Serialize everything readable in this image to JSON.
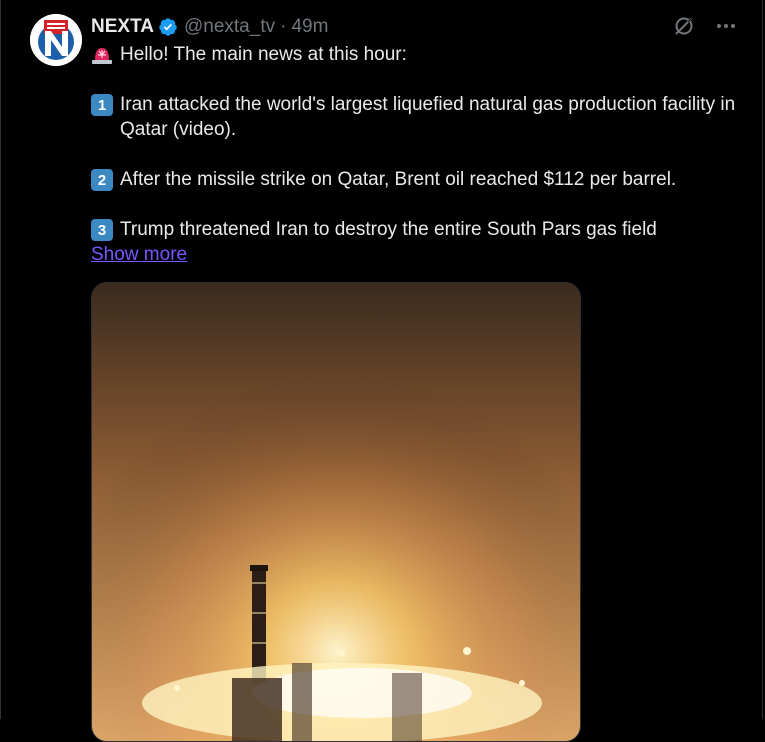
{
  "author": {
    "name": "NEXTA",
    "handle": "@nexta_tv",
    "separator": "·",
    "time": "49m",
    "verified": true,
    "avatar_letter": "N"
  },
  "icons": {
    "verified": "verified-badge-icon",
    "grok": "grok-icon",
    "more": "more-icon",
    "siren": "rotating-light-emoji"
  },
  "colors": {
    "background": "#000000",
    "text": "#e7e9ea",
    "muted": "#71767b",
    "link": "#7856ff",
    "verified": "#1d9bf0",
    "keycap": "#3b88c3",
    "avatar_red": "#d6232b",
    "avatar_blue": "#1d5fa8"
  },
  "post": {
    "intro": "Hello! The main news at this hour:",
    "items": [
      {
        "num": "1",
        "text": "Iran attacked the world's largest liquefied natural gas production facility in Qatar (video)."
      },
      {
        "num": "2",
        "text": "After the missile strike on Qatar, Brent oil reached $112 per barrel."
      },
      {
        "num": "3",
        "text": "Trump threatened Iran to destroy the entire South Pars gas field"
      }
    ],
    "show_more": "Show more"
  },
  "media": {
    "type": "video",
    "description_icon": "video-thumbnail"
  }
}
